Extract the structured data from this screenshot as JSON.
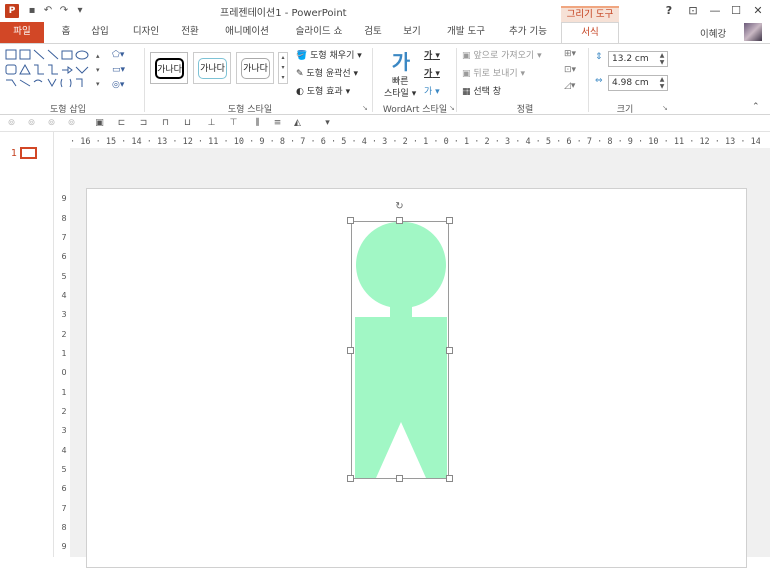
{
  "window": {
    "title": "프레젠테이션1 - PowerPoint",
    "app_logo": "P",
    "context_tab_header": "그리기 도구",
    "user": "이혜강",
    "help": "?",
    "min": "—",
    "restore": "☐",
    "close": "✕",
    "ribbon_opts": "⊡"
  },
  "tabs": [
    {
      "label": "파일"
    },
    {
      "label": "홈"
    },
    {
      "label": "삽입"
    },
    {
      "label": "디자인"
    },
    {
      "label": "전환"
    },
    {
      "label": "애니메이션"
    },
    {
      "label": "슬라이드 쇼"
    },
    {
      "label": "검토"
    },
    {
      "label": "보기"
    },
    {
      "label": "개발 도구"
    },
    {
      "label": "추가 기능"
    },
    {
      "label": "서식"
    }
  ],
  "ribbon": {
    "insert_shapes": {
      "label": "도형 삽입"
    },
    "shape_styles": {
      "label": "도형 스타일",
      "presets": [
        "가나다",
        "가나다",
        "가나다"
      ],
      "fill": "도형 채우기",
      "outline": "도형 윤곽선",
      "effects": "도형 효과"
    },
    "wordart": {
      "label": "WordArt 스타일",
      "quick_styles_l1": "빠른",
      "quick_styles_l2": "스타일",
      "quick_icon": "가",
      "text_fill_icon": "가",
      "text_outline_icon": "가",
      "text_effect_icon": "가"
    },
    "arrange": {
      "label": "정렬",
      "bring_forward": "앞으로 가져오기",
      "send_backward": "뒤로 보내기",
      "selection_pane": "선택 창"
    },
    "size": {
      "label": "크기",
      "height": "13.2 cm",
      "width": "4.98 cm"
    }
  },
  "slides": {
    "number": "1"
  },
  "rulers": {
    "horizontal": "· 16 · 15 · 14 · 13 · 12 · 11 · 10 · 9 · 8 · 7 · 6 · 5 · 4 · 3 · 2 · 1 · 0 · 1 · 2 · 3 · 4 · 5 · 6 · 7 · 8 · 9 · 10 · 11 · 12 · 13 · 14 · 15 · 16 ·",
    "vertical": [
      "9",
      "8",
      "7",
      "6",
      "5",
      "4",
      "3",
      "2",
      "1",
      "0",
      "1",
      "2",
      "3",
      "4",
      "5",
      "6",
      "7",
      "8",
      "9"
    ]
  },
  "colors": {
    "accent": "#d24726",
    "shape_fill": "#a1f7c5"
  }
}
